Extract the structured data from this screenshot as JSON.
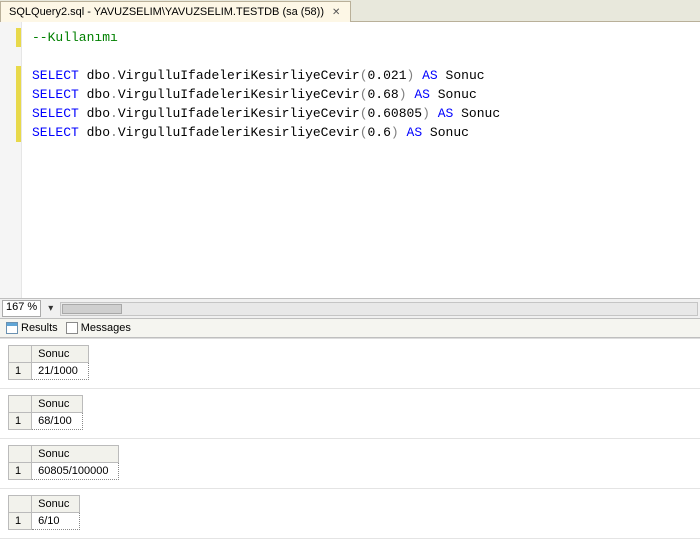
{
  "tab": {
    "title": "SQLQuery2.sql - YAVUZSELIM\\YAVUZSELIM.TESTDB (sa (58))"
  },
  "editor": {
    "comment": "--Kullanımı",
    "lines": [
      {
        "kw1": "SELECT",
        "schema": " dbo",
        "dot": ".",
        "func": "VirgulluIfadeleriKesirliyeCevir",
        "arg": "0.021",
        "kw2": " AS",
        "alias": " Sonuc"
      },
      {
        "kw1": "SELECT",
        "schema": " dbo",
        "dot": ".",
        "func": "VirgulluIfadeleriKesirliyeCevir",
        "arg": "0.68",
        "kw2": " AS",
        "alias": " Sonuc"
      },
      {
        "kw1": "SELECT",
        "schema": " dbo",
        "dot": ".",
        "func": "VirgulluIfadeleriKesirliyeCevir",
        "arg": "0.60805",
        "kw2": " AS",
        "alias": " Sonuc"
      },
      {
        "kw1": "SELECT",
        "schema": " dbo",
        "dot": ".",
        "func": "VirgulluIfadeleriKesirliyeCevir",
        "arg": "0.6",
        "kw2": " AS",
        "alias": " Sonuc"
      }
    ]
  },
  "zoom": {
    "value": "167 %"
  },
  "resultTabs": {
    "results": "Results",
    "messages": "Messages"
  },
  "resultSets": [
    {
      "col": "Sonuc",
      "rownum": "1",
      "value": "21/1000"
    },
    {
      "col": "Sonuc",
      "rownum": "1",
      "value": "68/100"
    },
    {
      "col": "Sonuc",
      "rownum": "1",
      "value": "60805/100000"
    },
    {
      "col": "Sonuc",
      "rownum": "1",
      "value": "6/10"
    }
  ]
}
